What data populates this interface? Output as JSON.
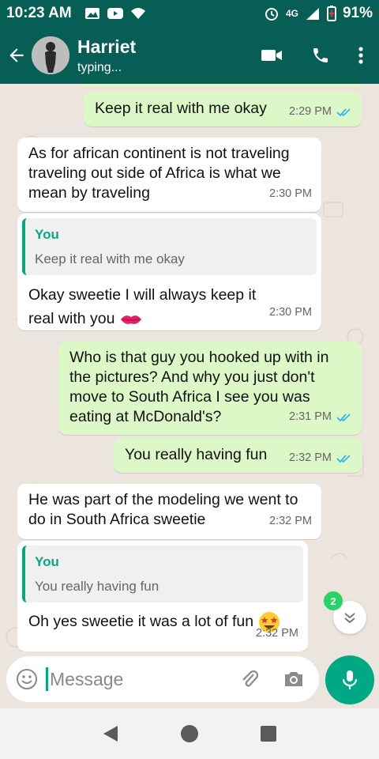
{
  "status_bar": {
    "time": "10:23 AM",
    "battery": "91%",
    "network": "4G"
  },
  "header": {
    "name": "Harriet",
    "status": "typing..."
  },
  "messages": [
    {
      "text": "Keep it real with me okay",
      "time": "2:29 PM"
    },
    {
      "text": "As for african continent is not traveling  traveling out side of Africa is what we mean by traveling",
      "time": "2:30 PM"
    },
    {
      "quote_author": "You",
      "quote_text": "Keep it real with me okay",
      "text": "Okay sweetie I will always keep it real with you",
      "time": "2:30 PM"
    },
    {
      "text": "Who is that guy you hooked up with in the pictures? And why you just don't move to South Africa I see you was eating at McDonald's?",
      "time": "2:31 PM"
    },
    {
      "text": "You really having fun",
      "time": "2:32 PM"
    },
    {
      "text": "He was part of the modeling we went to do in South Africa sweetie",
      "time": "2:32 PM"
    },
    {
      "quote_author": "You",
      "quote_text": "You really having fun",
      "text": "Oh yes sweetie it was a lot of fun",
      "time": "2:32 PM"
    }
  ],
  "unread_count": "2",
  "input": {
    "placeholder": "Message"
  },
  "colors": {
    "header": "#075e54",
    "outgoing": "#dcf8c6",
    "accent": "#00a884",
    "read_ticks": "#34b7f1"
  }
}
